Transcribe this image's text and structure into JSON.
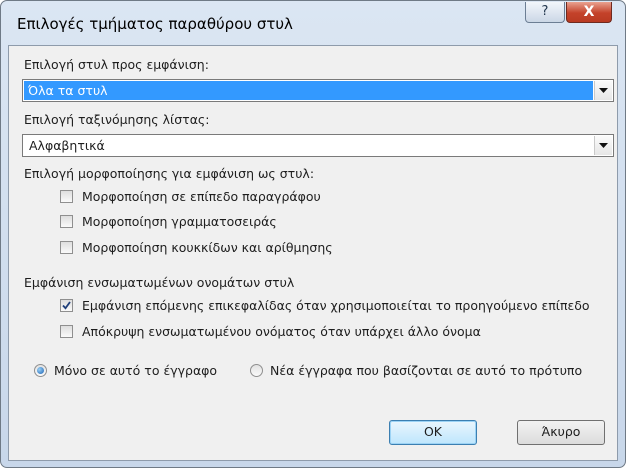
{
  "window": {
    "title": "Επιλογές τμήματος παραθύρου στυλ",
    "help_glyph": "?",
    "close_glyph": "X"
  },
  "style_select": {
    "label": "Επιλογή στυλ προς εμφάνιση:",
    "value": "Όλα τα στυλ"
  },
  "sort_select": {
    "label": "Επιλογή ταξινόμησης λίστας:",
    "value": "Αλφαβητικά"
  },
  "formatting": {
    "label": "Επιλογή μορφοποίησης για εμφάνιση ως στυλ:",
    "options": [
      {
        "label": "Μορφοποίηση σε επίπεδο παραγράφου",
        "checked": false
      },
      {
        "label": "Μορφοποίηση γραμματοσειράς",
        "checked": false
      },
      {
        "label": "Μορφοποίηση κουκκίδων και αρίθμησης",
        "checked": false
      }
    ]
  },
  "builtin_names": {
    "label": "Εμφάνιση ενσωματωμένων ονομάτων στυλ",
    "options": [
      {
        "label": "Εμφάνιση επόμενης επικεφαλίδας όταν χρησιμοποιείται το προηγούμενο επίπεδο",
        "checked": true
      },
      {
        "label": "Απόκρυψη ενσωματωμένου ονόματος όταν υπάρχει άλλο όνομα",
        "checked": false
      }
    ]
  },
  "scope": {
    "options": [
      {
        "label": "Μόνο σε αυτό το έγγραφο",
        "selected": true
      },
      {
        "label": "Νέα έγγραφα που βασίζονται σε αυτό το πρότυπο",
        "selected": false
      }
    ]
  },
  "buttons": {
    "ok": "OK",
    "cancel": "Άκυρο"
  }
}
